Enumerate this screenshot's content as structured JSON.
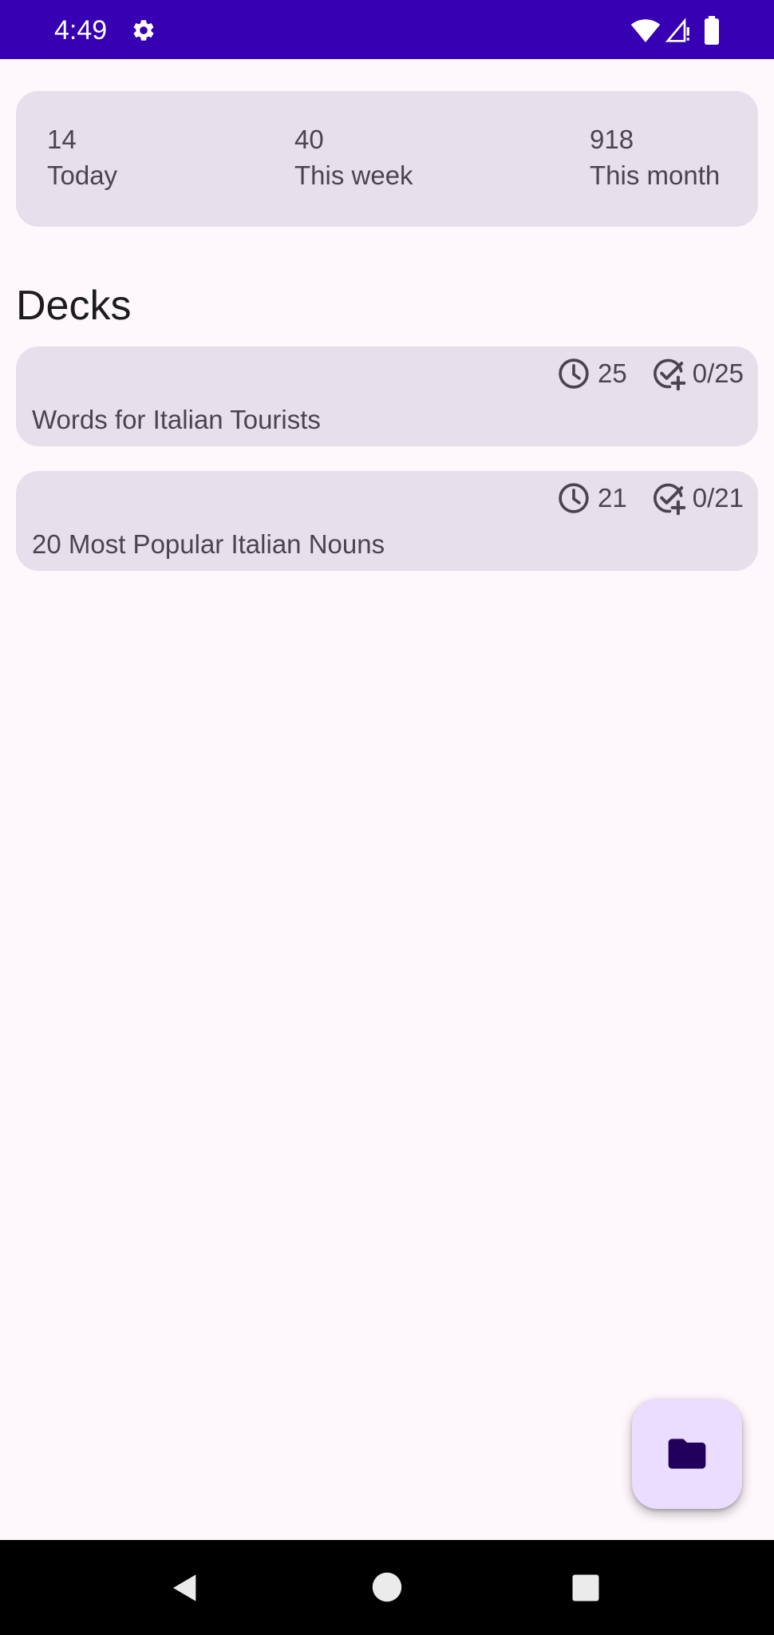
{
  "status_bar": {
    "time": "4:49",
    "icons": [
      "gear-icon",
      "wifi-icon",
      "signal-icon",
      "battery-icon"
    ],
    "background": "#3700B3"
  },
  "stats": [
    {
      "value": "14",
      "label": "Today"
    },
    {
      "value": "40",
      "label": "This week"
    },
    {
      "value": "918",
      "label": "This month"
    }
  ],
  "decks_title": "Decks",
  "decks": [
    {
      "name": "Words for Italian Tourists",
      "due": "25",
      "new": "0/25"
    },
    {
      "name": "20 Most Popular Italian Nouns",
      "due": "21",
      "new": "0/21"
    }
  ],
  "fab": {
    "icon": "folder-icon",
    "background": "#EADDFF"
  },
  "nav_bar": {
    "icons": [
      "back-icon",
      "home-icon",
      "recents-icon"
    ]
  },
  "colors": {
    "card": "#E7E0EC",
    "background": "#FEF8FD",
    "text": "#49454F",
    "title": "#1C1B1F",
    "fab_icon": "#21005D"
  }
}
